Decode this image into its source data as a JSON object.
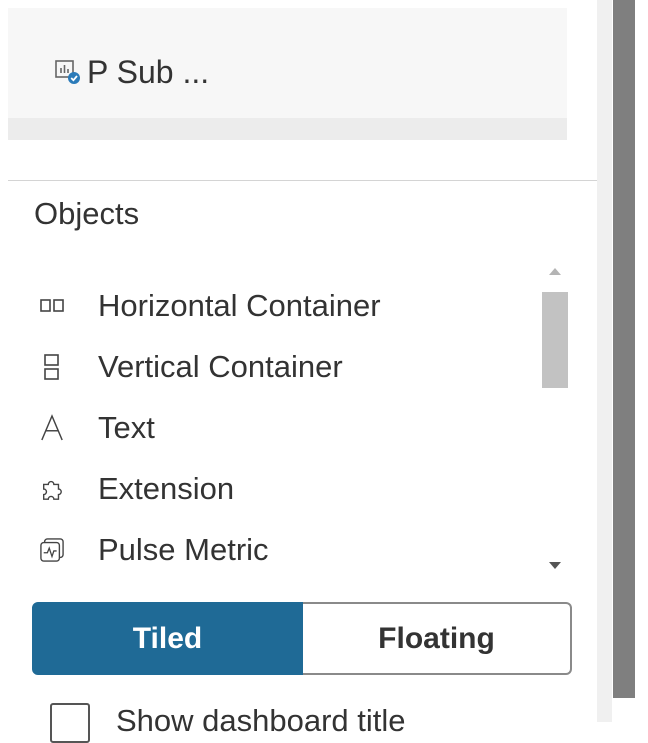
{
  "sheets": {
    "items": [
      {
        "label": "P Sub ...",
        "icon": "sheet-check-icon"
      }
    ]
  },
  "objects": {
    "title": "Objects",
    "items": [
      {
        "label": "Horizontal Container",
        "icon": "horizontal-container-icon"
      },
      {
        "label": "Vertical Container",
        "icon": "vertical-container-icon"
      },
      {
        "label": "Text",
        "icon": "text-icon"
      },
      {
        "label": "Extension",
        "icon": "extension-icon"
      },
      {
        "label": "Pulse Metric",
        "icon": "pulse-metric-icon"
      }
    ]
  },
  "layout_toggle": {
    "options": [
      "Tiled",
      "Floating"
    ],
    "selected": "Tiled"
  },
  "show_title": {
    "label": "Show dashboard title",
    "checked": false
  },
  "colors": {
    "accent": "#1f6a96",
    "text": "#333333",
    "rail": "#7f7f7f"
  }
}
